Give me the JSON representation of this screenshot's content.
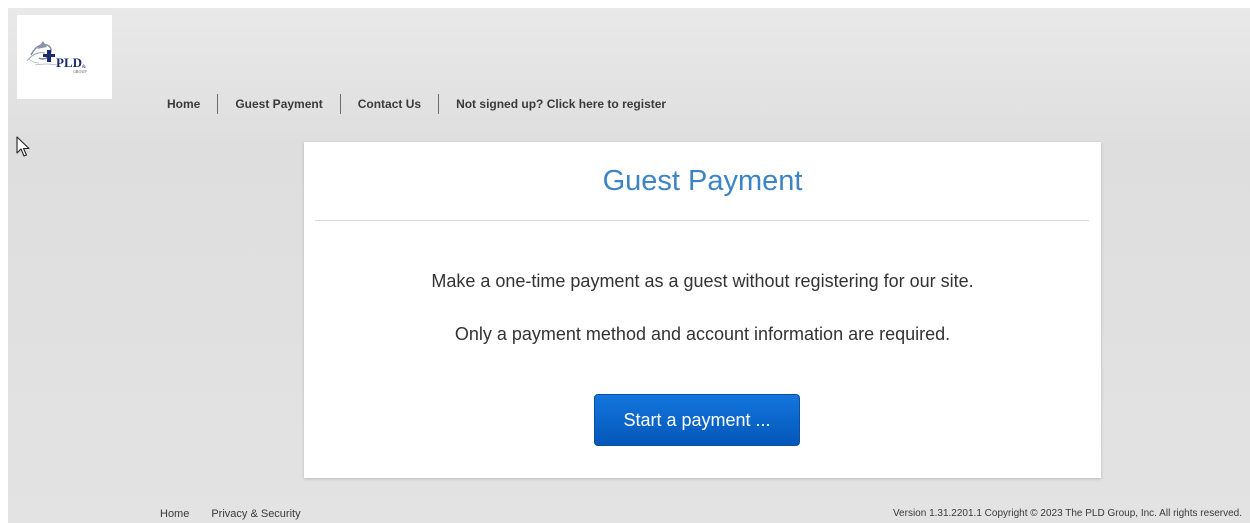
{
  "logo": {
    "text": "PLD",
    "subtext": "GROUP",
    "icon": "pld-group-logo-icon"
  },
  "nav": {
    "items": [
      {
        "label": "Home"
      },
      {
        "label": "Guest Payment"
      },
      {
        "label": "Contact Us"
      },
      {
        "label": "Not signed up? Click here to register"
      }
    ]
  },
  "cursor": {
    "icon": "mouse-pointer-icon"
  },
  "card": {
    "title": "Guest Payment",
    "line1": "Make a one-time payment as a guest without registering for our site.",
    "line2": "Only a payment method and account information are required.",
    "button_label": "Start a payment ..."
  },
  "footer": {
    "links": [
      {
        "label": "Home"
      },
      {
        "label": "Privacy & Security"
      }
    ],
    "copyright": "Version 1.31.2201.1 Copyright © 2023 The PLD Group, Inc. All rights reserved."
  },
  "colors": {
    "title": "#3c84c6",
    "button_top": "#1376de",
    "button_bottom": "#0457b8",
    "background": "#e3e3e3"
  }
}
